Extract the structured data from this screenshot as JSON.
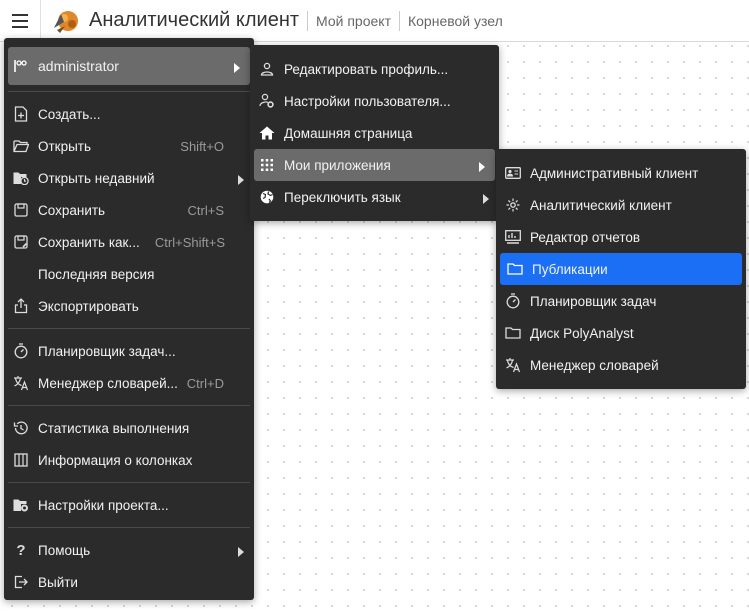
{
  "header": {
    "app_title": "Аналитический клиент",
    "crumb_project": "Мой проект",
    "crumb_node": "Корневой узел"
  },
  "main_menu": {
    "user": "administrator",
    "create": "Создать...",
    "open": "Открыть",
    "open_shortcut": "Shift+O",
    "open_recent": "Открыть недавний",
    "save": "Сохранить",
    "save_shortcut": "Ctrl+S",
    "save_as": "Сохранить как...",
    "save_as_shortcut": "Ctrl+Shift+S",
    "latest_version": "Последняя версия",
    "export": "Экспортировать",
    "scheduler": "Планировщик задач...",
    "dict_manager": "Менеджер словарей...",
    "dict_manager_shortcut": "Ctrl+D",
    "exec_stats": "Статистика выполнения",
    "column_info": "Информация о колонках",
    "project_settings": "Настройки проекта...",
    "help": "Помощь",
    "logout": "Выйти"
  },
  "user_menu": {
    "edit_profile": "Редактировать профиль...",
    "user_settings": "Настройки пользователя...",
    "home_page": "Домашняя страница",
    "my_apps": "Мои приложения",
    "switch_language": "Переключить язык"
  },
  "apps_menu": {
    "admin_client": "Административный клиент",
    "analytic_client": "Аналитический клиент",
    "report_editor": "Редактор отчетов",
    "publications": "Публикации",
    "task_scheduler": "Планировщик задач",
    "polyanalyst_disk": "Диск PolyAnalyst",
    "dictionary_manager": "Менеджер словарей"
  },
  "colors": {
    "menu_bg": "#2b2b2b",
    "highlight": "#6b6b6b",
    "accent": "#1a6ff5"
  }
}
